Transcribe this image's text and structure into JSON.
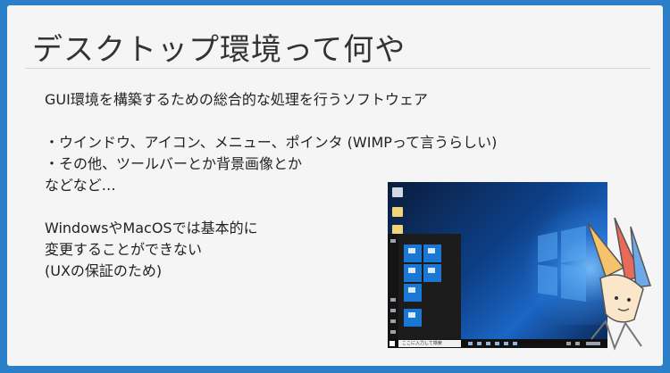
{
  "slide": {
    "title": "デスクトップ環境って何や",
    "lines": [
      "GUI環境を構築するための総合的な処理を行うソフトウェア",
      "",
      "・ウインドウ、アイコン、メニュー、ポインタ (WIMPって言うらしい)",
      "・その他、ツールバーとか背景画像とか",
      "などなど…",
      "",
      "WindowsやMacOSでは基本的に",
      "変更することができない",
      "(UXの保証のため)"
    ]
  },
  "screenshot": {
    "taskbar_search_text": "ここに入力して検索",
    "colors": {
      "wallpaper": "#0d3f86",
      "tile": "#1a78d4",
      "taskbar": "#101010"
    }
  },
  "decorations": {
    "doodle": "character-illustration-icon"
  }
}
